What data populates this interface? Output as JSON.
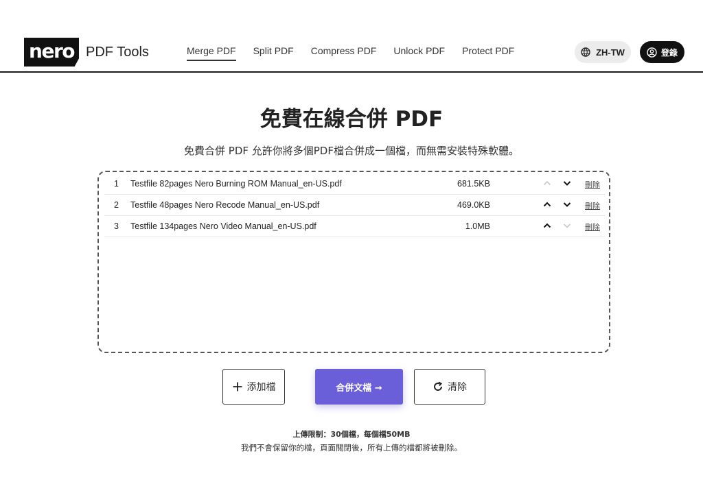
{
  "brand": {
    "logo_text": "nero",
    "app_name": "PDF Tools"
  },
  "nav": [
    {
      "label": "Merge PDF",
      "active": true
    },
    {
      "label": "Split PDF",
      "active": false
    },
    {
      "label": "Compress PDF",
      "active": false
    },
    {
      "label": "Unlock PDF",
      "active": false
    },
    {
      "label": "Protect PDF",
      "active": false
    }
  ],
  "header": {
    "lang_label": "ZH-TW",
    "login_label": "登錄"
  },
  "main": {
    "title": "免費在線合併 PDF",
    "subtitle": "免費合併 PDF 允許你將多個PDF檔合併成一個檔，而無需安裝特殊軟體。"
  },
  "files": [
    {
      "index": "1",
      "name": "Testfile 82pages Nero Burning ROM Manual_en-US.pdf",
      "size": "681.5KB",
      "up_enabled": false,
      "down_enabled": true,
      "delete_label": "刪除"
    },
    {
      "index": "2",
      "name": "Testfile 48pages Nero Recode Manual_en-US.pdf",
      "size": "469.0KB",
      "up_enabled": true,
      "down_enabled": true,
      "delete_label": "刪除"
    },
    {
      "index": "3",
      "name": "Testfile 134pages Nero Video Manual_en-US.pdf",
      "size": "1.0MB",
      "up_enabled": true,
      "down_enabled": false,
      "delete_label": "刪除"
    }
  ],
  "actions": {
    "add_label": "添加檔",
    "merge_label": "合併文檔 →",
    "clear_label": "清除"
  },
  "footer": {
    "limit_text": "上傳限制：30個檔，每個檔50MB",
    "privacy_text": "我們不會保留你的檔，頁面關閉後，所有上傳的檔都將被刪除。"
  },
  "colors": {
    "accent": "#6a5fd8",
    "dark": "#111111",
    "arrow_disabled": "#c8c8c8"
  }
}
